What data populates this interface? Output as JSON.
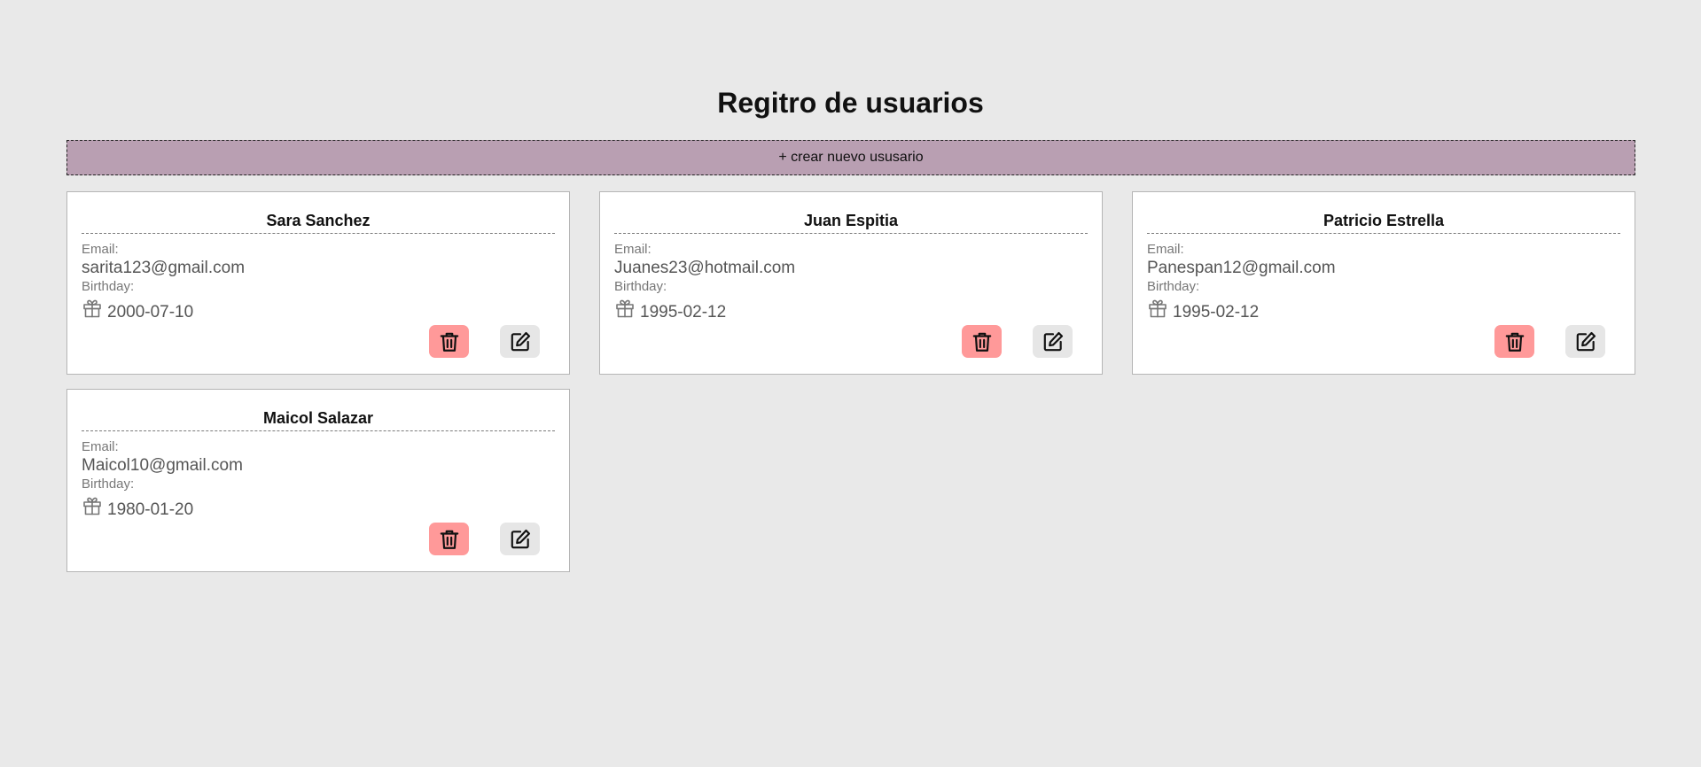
{
  "page": {
    "title": "Regitro de usuarios",
    "create_button_label": "+ crear nuevo ususario"
  },
  "labels": {
    "email": "Email:",
    "birthday": "Birthday:"
  },
  "colors": {
    "background": "#e9e9e9",
    "create_button": "#b99fb2",
    "delete_button": "#ff9999",
    "edit_button": "#e6e6e6"
  },
  "icons": {
    "birthday": "gift-icon",
    "delete": "trash-icon",
    "edit": "edit-icon"
  },
  "users": [
    {
      "name": "Sara Sanchez",
      "email": "sarita123@gmail.com",
      "birthday": "2000-07-10"
    },
    {
      "name": "Juan Espitia",
      "email": "Juanes23@hotmail.com",
      "birthday": "1995-02-12"
    },
    {
      "name": "Patricio Estrella",
      "email": "Panespan12@gmail.com",
      "birthday": "1995-02-12"
    },
    {
      "name": "Maicol Salazar",
      "email": "Maicol10@gmail.com",
      "birthday": "1980-01-20"
    }
  ]
}
